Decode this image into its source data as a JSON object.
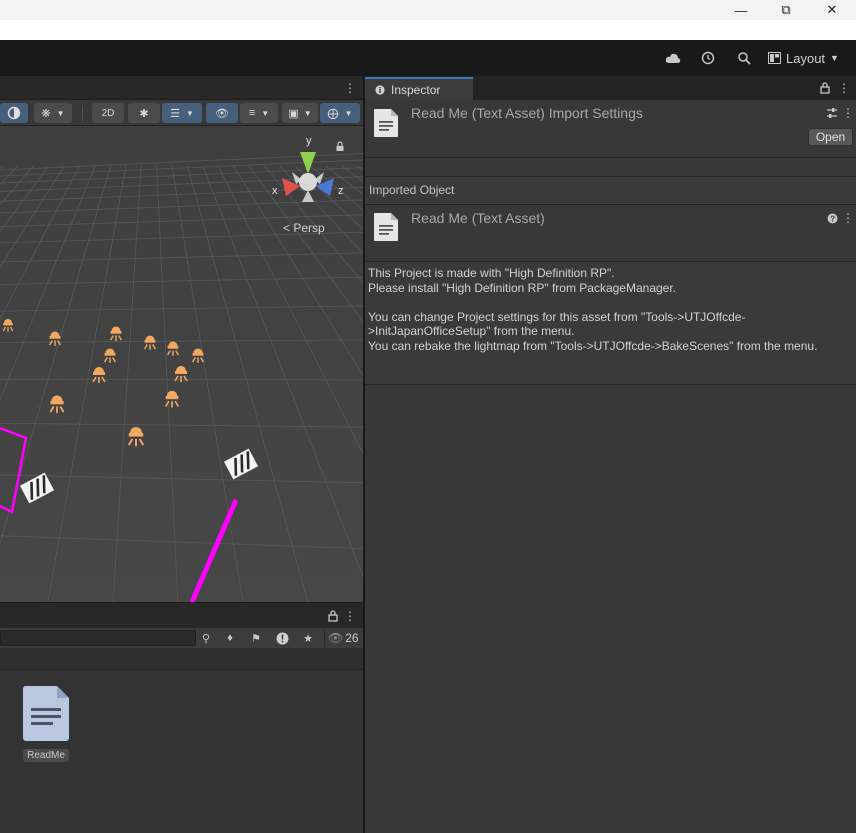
{
  "window": {
    "minimize_icon": "minimize-icon",
    "maximize_icon": "restore-icon",
    "close_icon": "close-icon"
  },
  "toolbar": {
    "layout_label": "Layout"
  },
  "scene": {
    "gizmo": {
      "y_label": "y",
      "x_label": "x",
      "z_label": "z"
    },
    "persp_label": "< Persp"
  },
  "project": {
    "visible_count": "26",
    "asset_label": "ReadMe"
  },
  "inspector": {
    "tab_label": "Inspector",
    "header_title": "Read Me (Text Asset) Import Settings",
    "open_button": "Open",
    "section_label": "Imported Object",
    "asset_title": "Read Me (Text Asset)",
    "readme_text": "This Project is made with \"High Definition RP\".\nPlease install \"High Definition RP\" from PackageManager.\n\nYou can change Project settings for this asset from \"Tools->UTJOffcde-\n>InitJapanOfficeSetup\" from the menu.\nYou can rebake the lightmap from \"Tools->UTJOffcde->BakeScenes\" from the menu."
  },
  "colors": {
    "accent": "#3a79bb",
    "light_icon": "#f2a860",
    "selection_magenta": "#ff00ff"
  }
}
